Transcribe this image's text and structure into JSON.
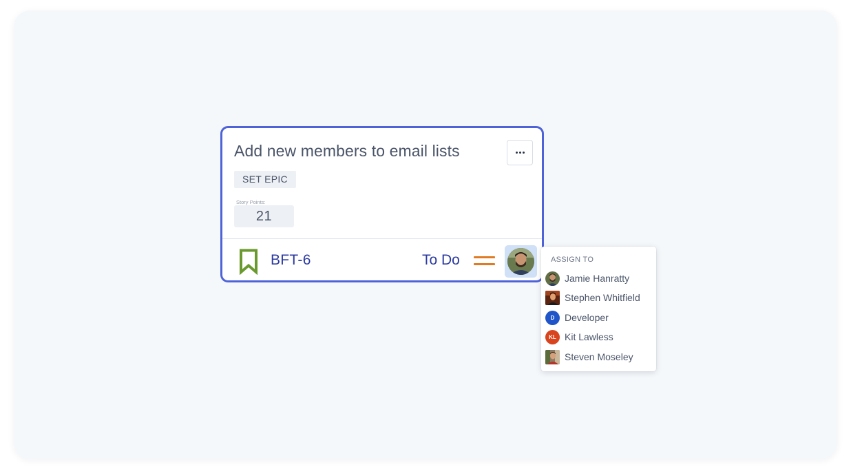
{
  "card": {
    "title": "Add new members to email lists",
    "more_icon": "ellipsis-icon",
    "epic_button_label": "SET EPIC",
    "story_points_label": "Story Points:",
    "story_points_value": "21",
    "issue_type_icon": "bookmark-icon",
    "issue_key": "BFT-6",
    "status": "To Do",
    "priority_icon": "priority-medium-icon",
    "assignee_avatar_icon": "user-avatar",
    "colors": {
      "border": "#4f63d9",
      "issue_key": "#2b3aa0",
      "bookmark": "#6a9a2e",
      "priority": "#e07b23"
    }
  },
  "assign_dropdown": {
    "header": "ASSIGN TO",
    "users": [
      {
        "name": "Jamie Hanratty",
        "avatar": "photo",
        "initials": ""
      },
      {
        "name": "Stephen Whitfield",
        "avatar": "photo",
        "initials": ""
      },
      {
        "name": "Developer",
        "avatar": "initials",
        "initials": "D",
        "color": "#1f55c8"
      },
      {
        "name": "Kit Lawless",
        "avatar": "initials",
        "initials": "KL",
        "color": "#d8441d"
      },
      {
        "name": "Steven Moseley",
        "avatar": "photo",
        "initials": ""
      }
    ]
  }
}
